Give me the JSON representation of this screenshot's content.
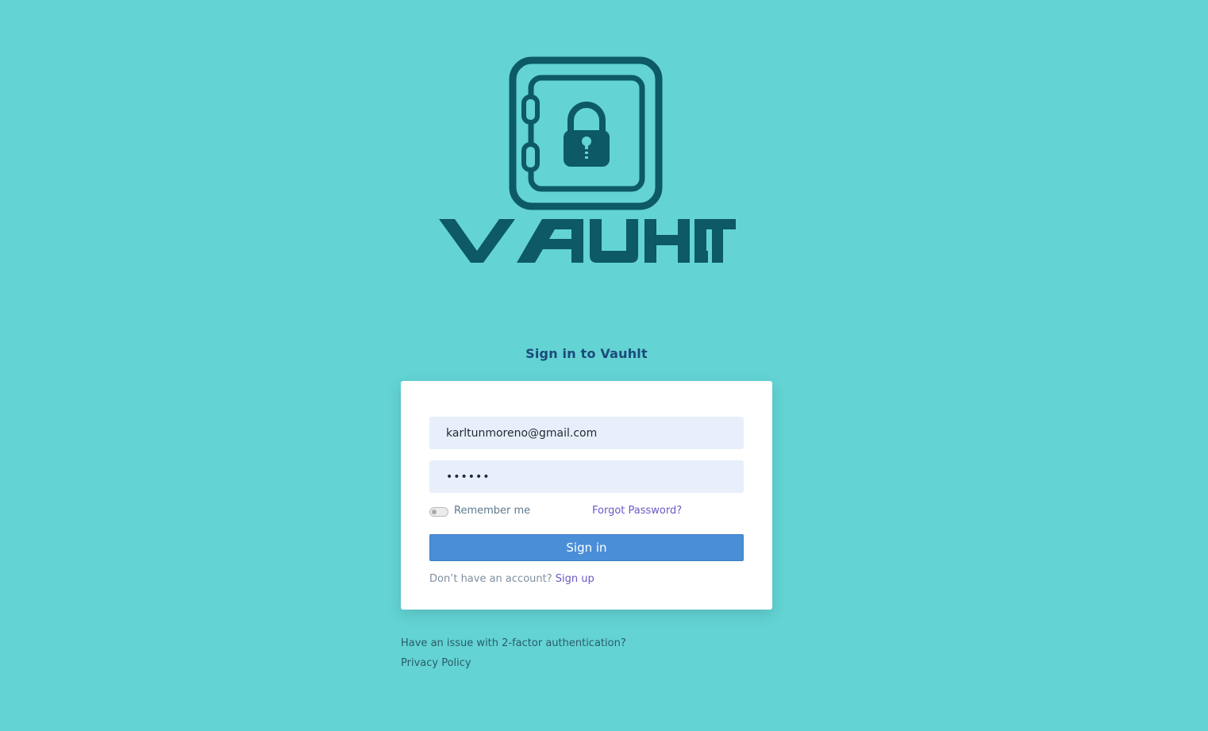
{
  "brand": {
    "name": "VAUHLT",
    "logo_icon": "vault-lock-icon",
    "color": "#0d5966"
  },
  "colors": {
    "background": "#63d3d4",
    "accent": "#4a8ed8",
    "link": "#6b58c7"
  },
  "signin": {
    "heading": "Sign in to Vauhlt",
    "email_value": "karltunmoreno@gmail.com",
    "password_value": "••••••",
    "remember_label": "Remember me",
    "remember_checked": false,
    "forgot_label": "Forgot Password?",
    "submit_label": "Sign in",
    "no_account_text": "Don’t have an account?",
    "signup_label": "Sign up"
  },
  "footer": {
    "two_factor_link": "Have an issue with 2-factor authentication?",
    "privacy_link": "Privacy Policy"
  }
}
